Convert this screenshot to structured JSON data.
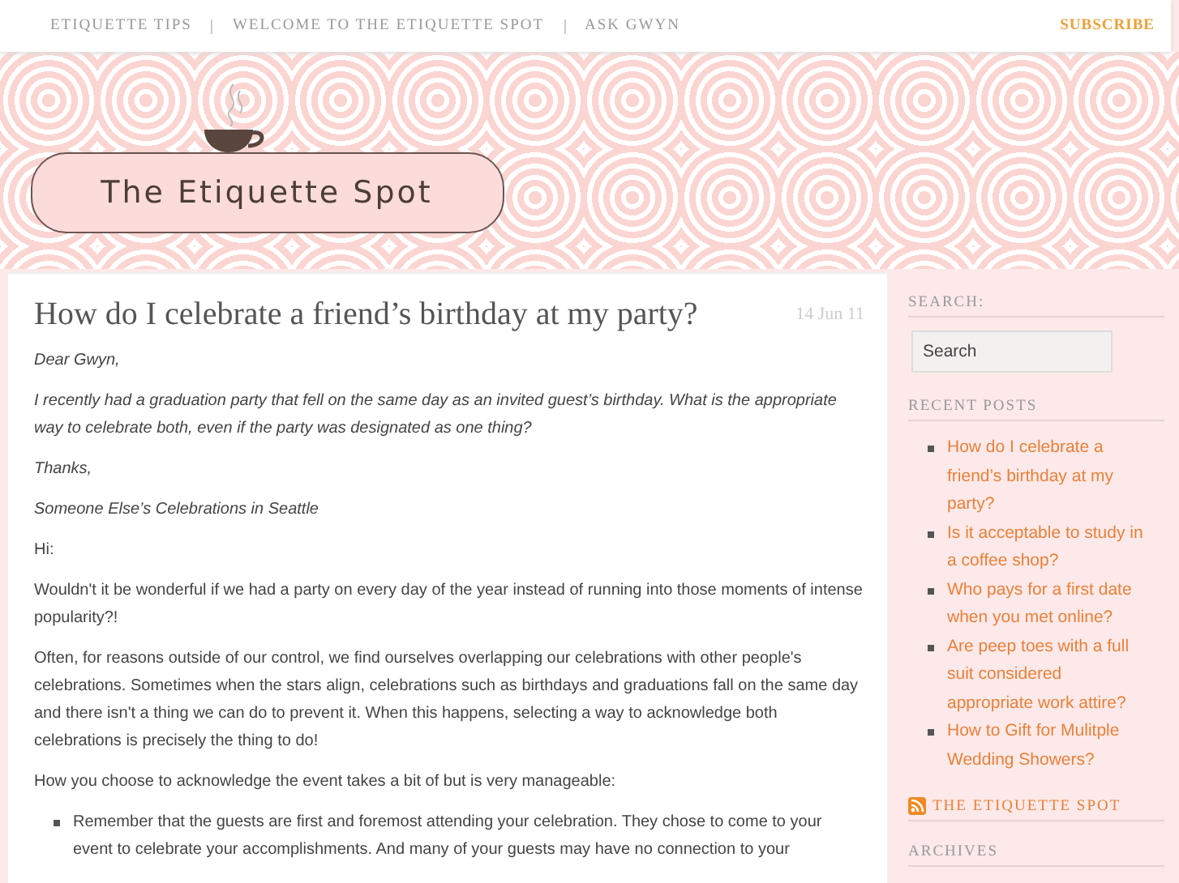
{
  "top_nav": {
    "links": [
      "ETIQUETTE TIPS",
      "WELCOME TO THE ETIQUETTE SPOT",
      "ASK GWYN"
    ],
    "subscribe": "SUBSCRIBE"
  },
  "header": {
    "logo_text": "The Etiquette Spot"
  },
  "post": {
    "title": "How do I celebrate a friend’s birthday at my party?",
    "date": "14 Jun 11",
    "paragraphs": [
      {
        "kind": "letter",
        "text": "Dear Gwyn,"
      },
      {
        "kind": "letter",
        "text": "I recently had a graduation party that fell on the same day as an invited guest’s birthday.  What is the appropriate way to celebrate both, even if the party was designated as one thing?"
      },
      {
        "kind": "letter",
        "text": "Thanks,"
      },
      {
        "kind": "letter",
        "text": "Someone Else’s Celebrations in Seattle"
      },
      {
        "kind": "reply",
        "text": "Hi:"
      },
      {
        "kind": "reply",
        "text": "Wouldn't it be wonderful if we had a party on every day of the year instead of running into those moments of intense popularity?!"
      },
      {
        "kind": "reply",
        "text": "Often, for reasons outside of our control, we find ourselves overlapping our celebrations with other people's celebrations.  Sometimes when the stars align, celebrations such as birthdays and graduations fall on the same day and there isn't a thing we can do to prevent it.  When this happens, selecting a way to acknowledge both celebrations is precisely the thing to do!"
      },
      {
        "kind": "reply",
        "text": "How you choose to acknowledge the event takes a bit of but is very manageable:"
      }
    ],
    "bullets": [
      "Remember that the guests are first and foremost attending your celebration. They chose to come to your event to celebrate your accomplishments. And many of your guests may have no connection to your"
    ]
  },
  "sidebar": {
    "search_heading": "SEARCH:",
    "search": {
      "placeholder": "Search"
    },
    "recent_heading": "RECENT POSTS",
    "recent_posts": [
      "How do I celebrate a friend’s birthday at my party?",
      "Is it acceptable to study in a coffee shop?",
      "Who pays for a first date when you met online?",
      "Are peep toes with a full suit considered appropriate work attire?",
      "How to Gift for Mulitple Wedding Showers?"
    ],
    "feed_heading": "THE ETIQUETTE SPOT",
    "archives_heading": "ARCHIVES"
  }
}
